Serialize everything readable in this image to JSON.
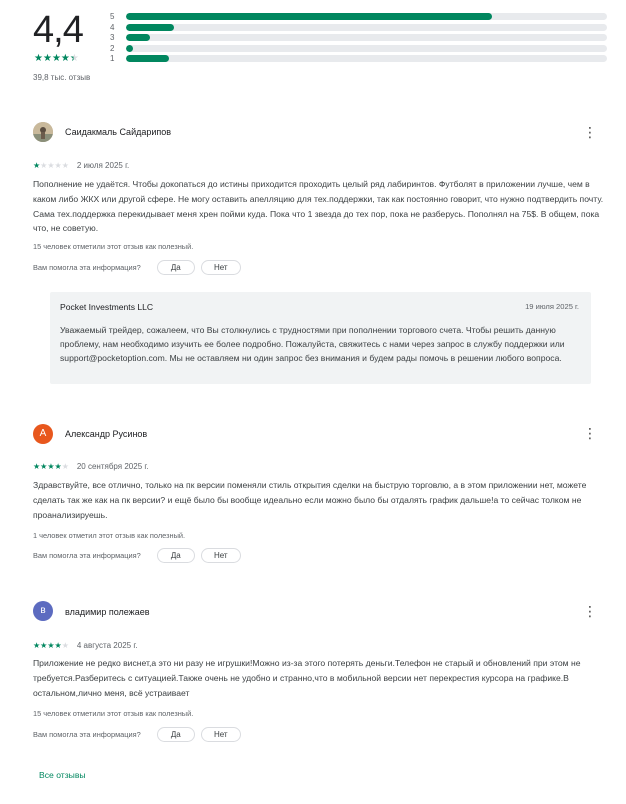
{
  "summary": {
    "score": "4,4",
    "stars_text": "★★★★★",
    "rating_fraction": 0.88,
    "count_text": "39,8 тыс. отзыв",
    "histogram": [
      {
        "label": "5",
        "fraction": 0.76
      },
      {
        "label": "4",
        "fraction": 0.1
      },
      {
        "label": "3",
        "fraction": 0.05
      },
      {
        "label": "2",
        "fraction": 0.015
      },
      {
        "label": "1",
        "fraction": 0.09
      }
    ],
    "accent_color": "#01875f"
  },
  "reviews": [
    {
      "author": "Саидакмаль Сайдарипов",
      "avatar_icon": "photo-avatar",
      "rating": 1,
      "date": "2 июля 2025 г.",
      "text": "Пополнение не удаётся. Чтобы докопаться до истины приходится проходить целый ряд лабиринтов. Футболят в приложении лучше, чем в каком либо ЖКХ или другой сфере. Не могу оставить апелляцию для тех.поддержки, так как постоянно говорит, что нужно подтвердить почту. Сама тех.поддержка перекидывает меня хрен пойми куда. Пока что 1 звезда до тех пор, пока не разберусь. Пополнял на 75$. В общем, пока что, не советую.",
      "helpful": "15 человек отметили этот отзыв как полезный.",
      "question": "Вам помогла эта информация?",
      "yes_label": "Да",
      "no_label": "Нет",
      "reply": {
        "developer": "Pocket Investments LLC",
        "date": "19 июля 2025 г.",
        "text": "Уважаемый трейдер, сожалеем, что Вы столкнулись с трудностями при пополнении торгового счета. Чтобы решить данную проблему, нам необходимо изучить ее более подробно. Пожалуйста, свяжитесь с нами через запрос в службу поддержки или support@pocketoption.com. Мы не оставляем ни один запрос без внимания и будем рады помочь в решении любого вопроса."
      }
    },
    {
      "author": "Александр Русинов",
      "avatar_letter": "А",
      "avatar_color": "#e8571d",
      "rating": 4,
      "date": "20 сентября 2025 г.",
      "text": "Здравствуйте, все отлично, только на пк версии поменяли стиль открытия сделки на быструю торговлю, а в этом приложении нет, можете сделать так же как на пк версии? и ещё было бы вообще идеально если можно было бы отдалять график дальше!а то сейчас толком не проанализируешь.",
      "helpful": "1 человек отметил этот отзыв как полезный.",
      "question": "Вам помогла эта информация?",
      "yes_label": "Да",
      "no_label": "Нет"
    },
    {
      "author": "владимир полежаев",
      "avatar_letter": "в",
      "avatar_color": "#5c6bc0",
      "rating": 4,
      "date": "4 августа 2025 г.",
      "text": "Приложение не редко виснет,а это ни разу не игрушки!Можно из-за этого потерять деньги.Телефон не старый и обновлений при этом не требуется.Разберитесь с ситуацией.Также очень не удобно и странно,что в мобильной версии нет перекрестия курсора на графике.В остальном,лично меня, всё устраивает",
      "helpful": "15 человек отметили этот отзыв как полезный.",
      "question": "Вам помогла эта информация?",
      "yes_label": "Да",
      "no_label": "Нет"
    }
  ],
  "footer": {
    "all_reviews_label": "Все отзывы"
  }
}
